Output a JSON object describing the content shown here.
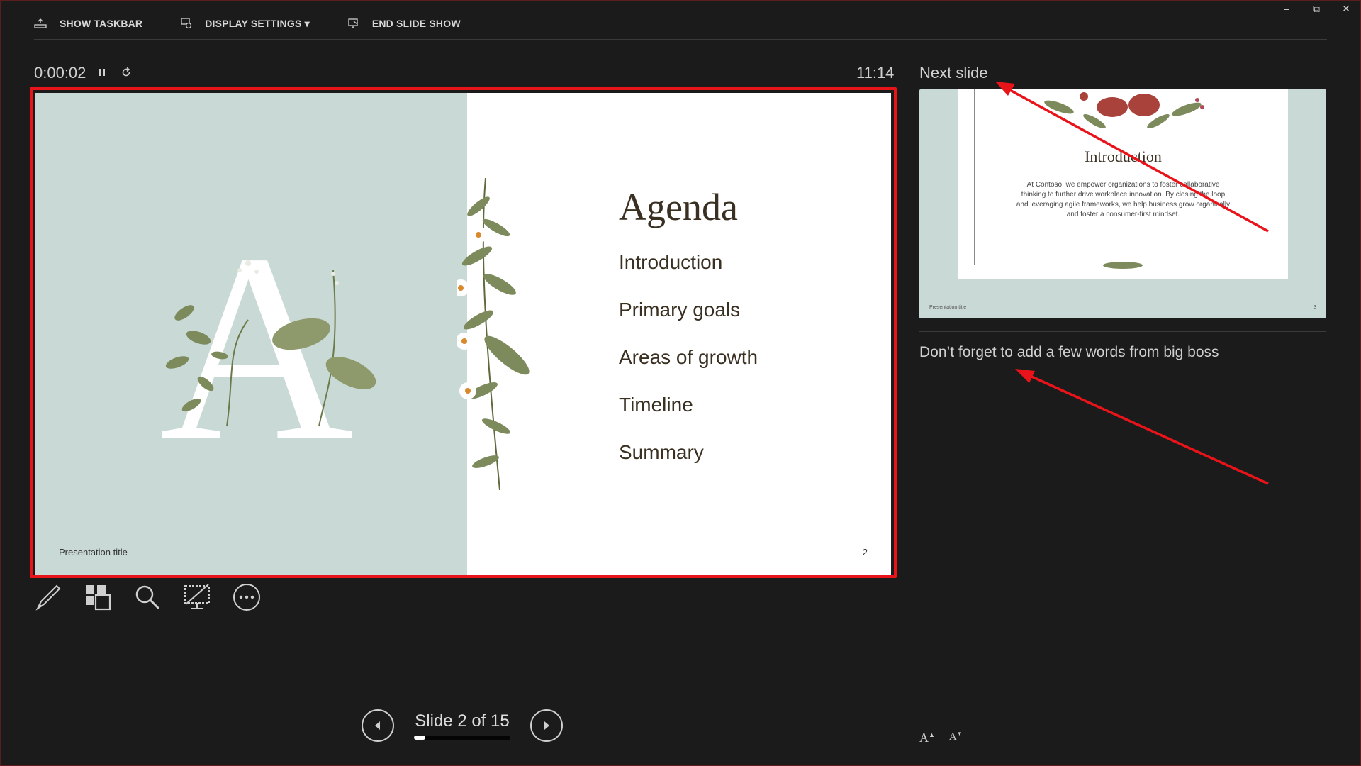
{
  "toolbar": {
    "show_taskbar": "SHOW TASKBAR",
    "display_settings": "DISPLAY SETTINGS ▾",
    "end_slide_show": "END SLIDE SHOW"
  },
  "window_controls": {
    "minimize": "–",
    "restore": "⧉",
    "close": "✕"
  },
  "timer": {
    "elapsed": "0:00:02",
    "clock": "11:14"
  },
  "current_slide": {
    "big_letter": "A",
    "title": "Agenda",
    "items": [
      "Introduction",
      "Primary goals",
      "Areas of growth",
      "Timeline",
      "Summary"
    ],
    "footer": "Presentation title",
    "page_number": "2",
    "colors": {
      "left_panel": "#c9d9d5",
      "text": "#3a3022",
      "highlight_border": "#e8141a"
    }
  },
  "tools": [
    "pen-icon",
    "see-all-slides-icon",
    "zoom-icon",
    "black-screen-icon",
    "more-options-icon"
  ],
  "navigation": {
    "label": "Slide 2 of 15",
    "current": 2,
    "total": 15,
    "progress_fraction": 0.12
  },
  "next_slide": {
    "label": "Next slide",
    "title": "Introduction",
    "body": "At Contoso, we empower organizations to foster collaborative thinking to further drive workplace innovation. By closing the loop and leveraging agile frameworks, we help business grow organically and foster a consumer-first mindset.",
    "footer": "Presentation title",
    "page_number": "3"
  },
  "notes": {
    "text": "Don’t forget to add a few words from big boss"
  },
  "font_size": {
    "increase": "A",
    "decrease": "A"
  },
  "annotation_color": "#e8141a"
}
